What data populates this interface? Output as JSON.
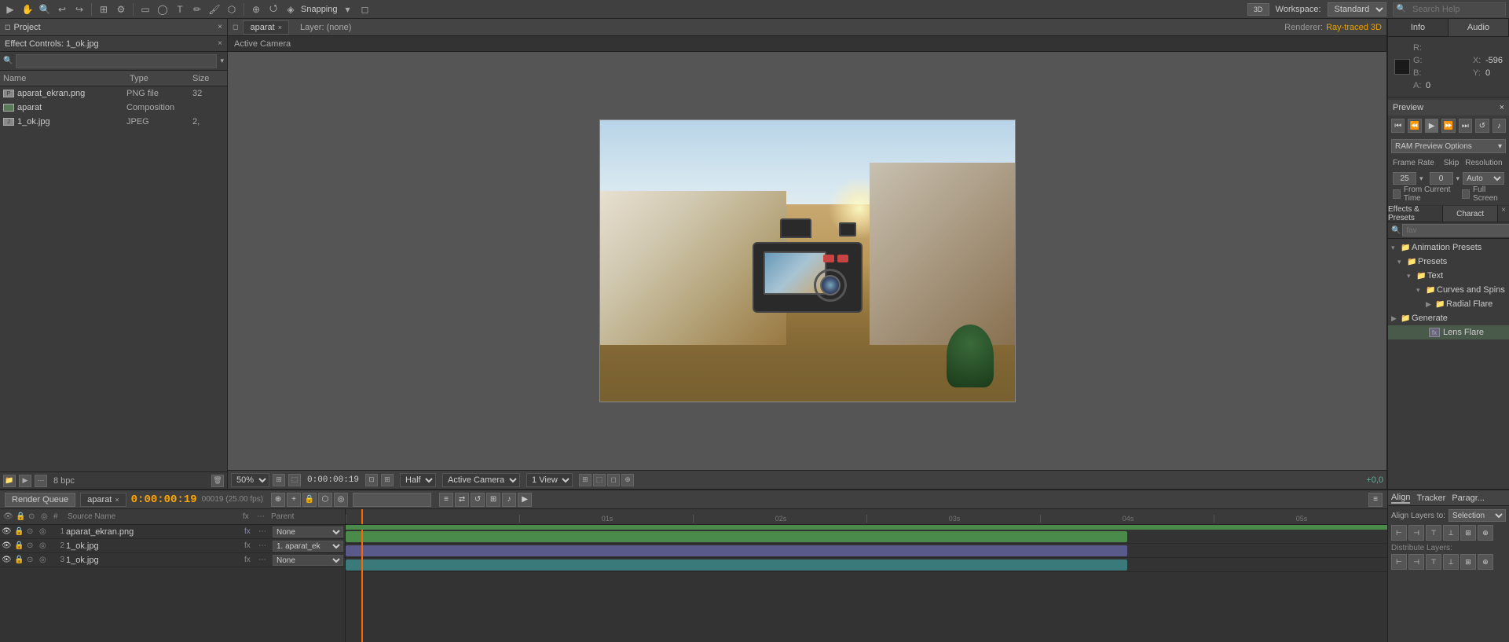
{
  "toolbar": {
    "workspace_label": "Workspace:",
    "workspace_value": "Standard",
    "search_placeholder": "Search Help",
    "snapping_label": "Snapping"
  },
  "project_panel": {
    "title": "Project",
    "effect_controls_tab": "Effect Controls: 1_ok.jpg",
    "close_label": "×",
    "columns": {
      "name": "Name",
      "type": "Type",
      "size": "Size"
    },
    "items": [
      {
        "name": "aparat_ekran.png",
        "type": "PNG file",
        "size": "32",
        "icon": "png"
      },
      {
        "name": "aparat",
        "type": "Composition",
        "size": "",
        "icon": "comp"
      },
      {
        "name": "1_ok.jpg",
        "type": "JPEG",
        "size": "2,",
        "icon": "jpeg"
      }
    ],
    "bottom": "8 bpc"
  },
  "composition_panel": {
    "title": "Composition: aparat",
    "close_label": "×",
    "tab_label": "aparat",
    "layer_info": "Layer: (none)",
    "renderer_label": "Renderer:",
    "renderer_value": "Ray-traced 3D",
    "active_camera": "Active Camera",
    "zoom": "50%",
    "time": "0:00:00:19",
    "quality": "Half",
    "camera_view": "Active Camera",
    "view_count": "1 View"
  },
  "info_panel": {
    "title": "Info",
    "audio_tab": "Audio",
    "r_label": "R:",
    "g_label": "G:",
    "b_label": "B:",
    "a_label": "A:",
    "r_value": "",
    "g_value": "",
    "b_value": "",
    "a_value": "0",
    "x_label": "X:",
    "y_label": "Y:",
    "x_value": "-596",
    "y_value": "0"
  },
  "preview_panel": {
    "title": "Preview",
    "close_label": "×",
    "ram_preview_label": "RAM Preview Options",
    "frame_rate_label": "Frame Rate",
    "skip_label": "Skip",
    "resolution_label": "Resolution",
    "frame_rate_value": "25",
    "skip_value": "0",
    "resolution_value": "Auto",
    "from_current_time_label": "From Current Time",
    "full_screen_label": "Full Screen"
  },
  "effects_panel": {
    "title": "Effects & Presets",
    "char_tab": "Charact",
    "close_label": "×",
    "search_placeholder": "fav",
    "tree": {
      "animation_presets": "Animation Presets",
      "presets": "Presets",
      "text": "Text",
      "curves_spins": "Curves and Spins",
      "radial_flare": "Radial Flare",
      "generate": "Generate",
      "lens_flare": "Lens Flare"
    }
  },
  "timeline_panel": {
    "title": "aparat",
    "close_label": "×",
    "render_queue_tab": "Render Queue",
    "time_display": "0:00:00:19",
    "fps_display": "00019 (25.00 fps)",
    "layers": [
      {
        "num": "1",
        "name": "aparat_ekran.png",
        "source": "None",
        "has_effects": true
      },
      {
        "num": "2",
        "name": "1_ok.jpg",
        "source": "1. aparat_ek",
        "has_effects": false
      },
      {
        "num": "3",
        "name": "1_ok.jpg",
        "source": "None",
        "has_effects": false
      }
    ],
    "ruler_marks": [
      "",
      "01s",
      "02s",
      "03s",
      "04s",
      "05s"
    ]
  },
  "align_panel": {
    "title": "Align",
    "tracker_tab": "Tracker",
    "paragr_tab": "Paragr...",
    "align_layers_to_label": "Align Layers to:",
    "selection_label": "Selection",
    "distribute_label": "Distribute Layers:"
  }
}
